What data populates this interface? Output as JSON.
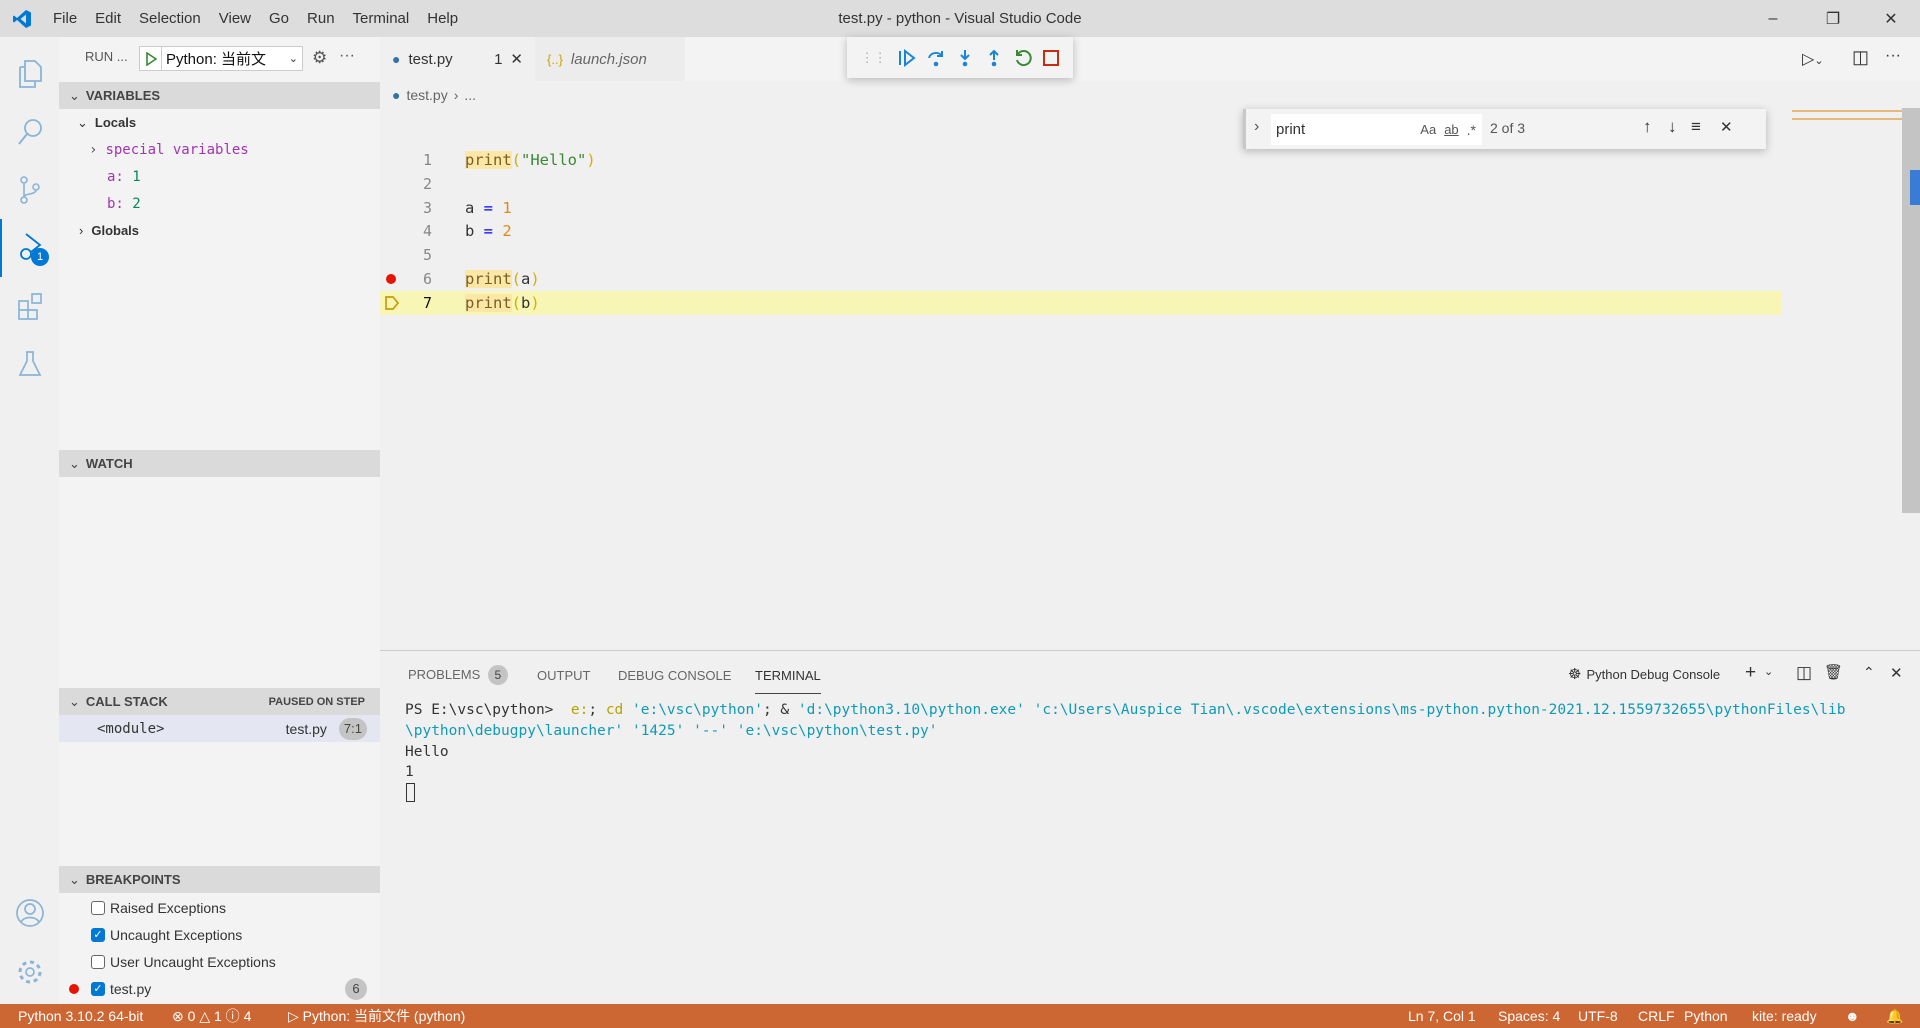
{
  "titlebar": {
    "menus": [
      "File",
      "Edit",
      "Selection",
      "View",
      "Go",
      "Run",
      "Terminal",
      "Help"
    ],
    "title": "test.py - python - Visual Studio Code"
  },
  "activity": {
    "debug_badge": "1"
  },
  "run": {
    "label": "RUN ...",
    "config": "Python: 当前文"
  },
  "variables": {
    "header": "VARIABLES",
    "locals": "Locals",
    "special": "special variables",
    "items": [
      {
        "name": "a:",
        "value": "1"
      },
      {
        "name": "b:",
        "value": "2"
      }
    ],
    "globals": "Globals"
  },
  "watch": {
    "header": "WATCH"
  },
  "callstack": {
    "header": "CALL STACK",
    "status": "PAUSED ON STEP",
    "frames": [
      {
        "name": "<module>",
        "file": "test.py",
        "pos": "7:1"
      }
    ]
  },
  "breakpoints": {
    "header": "BREAKPOINTS",
    "items": [
      {
        "label": "Raised Exceptions",
        "checked": false
      },
      {
        "label": "Uncaught Exceptions",
        "checked": true
      },
      {
        "label": "User Uncaught Exceptions",
        "checked": false
      },
      {
        "label": "test.py",
        "checked": true,
        "count": "6"
      }
    ]
  },
  "tabs": [
    {
      "label": "test.py",
      "badge": "1",
      "active": true
    },
    {
      "label": "launch.json",
      "active": false
    }
  ],
  "breadcrumb": {
    "file": "test.py",
    "rest": "..."
  },
  "code": {
    "lines": [
      "1",
      "2",
      "3",
      "4",
      "5",
      "6",
      "7"
    ],
    "l1": {
      "fn": "print",
      "a": "(",
      "s": "\"Hello\"",
      "b": ")"
    },
    "l3": {
      "v": "a",
      "op": " = ",
      "n": "1"
    },
    "l4": {
      "v": "b",
      "op": " = ",
      "n": "2"
    },
    "l6": {
      "fn": "print",
      "a": "(",
      "v": "a",
      "b": ")"
    },
    "l7": {
      "fn": "print",
      "a": "(",
      "v": "b",
      "b": ")"
    }
  },
  "find": {
    "value": "print",
    "case": "Aa",
    "word": "ab",
    "regex": ".*",
    "count": "2 of 3"
  },
  "panel": {
    "tabs": [
      "PROBLEMS",
      "OUTPUT",
      "DEBUG CONSOLE",
      "TERMINAL"
    ],
    "problems_count": "5",
    "active": "TERMINAL",
    "terminal_name": "Python Debug Console"
  },
  "terminal": {
    "prompt": "PS E:\\vsc\\python> ",
    "cmd1": " e:",
    "sep1": "; ",
    "cd": "cd",
    "path1": " 'e:\\vsc\\python'",
    "sep2": "; & ",
    "exe": "'d:\\python3.10\\python.exe'",
    "arg1": " 'c:\\Users\\Auspice Tian\\.vscode\\extensions\\ms-python.python-2021.12.1559732655\\pythonFiles\\lib",
    "arg1b": "\\python\\debugpy\\launcher' '1425' '--' 'e:\\vsc\\python\\test.py'",
    "out": [
      "Hello",
      "1"
    ]
  },
  "status": {
    "interpreter": "Python 3.10.2 64-bit",
    "errors": "0",
    "warnings": "1",
    "infos": "4",
    "debug": "Python: 当前文件 (python)",
    "position": "Ln 7, Col 1",
    "spaces": "Spaces: 4",
    "encoding": "UTF-8",
    "eol": "CRLF",
    "language": "Python",
    "kite": "kite: ready"
  },
  "colors": {
    "status_bar": "#cc6633",
    "accent": "#0078d4",
    "breakpoint": "#e51400",
    "current_line": "#f8f6b4"
  }
}
